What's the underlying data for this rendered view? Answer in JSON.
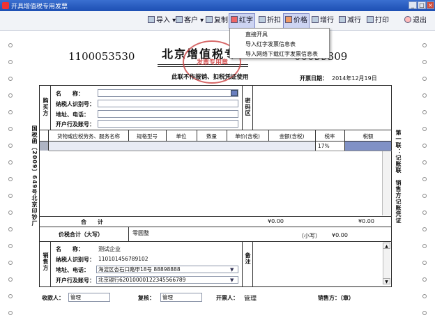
{
  "window": {
    "title": "开具增值税专用发票",
    "min": "_",
    "max": "□",
    "close": "×"
  },
  "toolbar": {
    "import": "导入",
    "client": "客户",
    "copy": "复制",
    "red": "红字",
    "discount": "折扣",
    "price": "价格",
    "add_row": "增行",
    "del_row": "减行",
    "print": "打印",
    "exit": "退出"
  },
  "menu": {
    "item1": "直接开具",
    "item2": "导入红字发票信息表",
    "item3": "导入网络下载红字发票信息表"
  },
  "invoice": {
    "code": "1100053530",
    "title": "北京增值税专",
    "number": "00099309",
    "notice": "此联不作报销、扣税凭证使用",
    "date_label": "开票日期：",
    "date": "2014年12月19日",
    "buyer_side": "购买方",
    "buyer_name_label": "名　　称：",
    "buyer_tax_label": "纳税人识别号：",
    "buyer_addr_label": "地址、电话：",
    "buyer_bank_label": "开户行及账号：",
    "cipher": "密码区",
    "left_vertical": "国税函〔2009〕649号北京印钞厂",
    "right_vertical": "第一联：记账联　销售方记账凭证",
    "headers": [
      "货物或应税劳务、服务名称",
      "规格型号",
      "单位",
      "数量",
      "单价(含税)",
      "金额(含税)",
      "税率",
      "税额"
    ],
    "tax_rate": "17%",
    "total_label": "合　　计",
    "total_amount": "¥0.00",
    "total_tax": "¥0.00",
    "sum_label": "价税合计（大写）",
    "sum_words": "零圆整",
    "sum_small_label": "（小写）",
    "sum_small": "¥0.00",
    "seller_side": "销售方",
    "seller_name_label": "名　　称：",
    "seller_name": "测试企业",
    "seller_tax_label": "纳税人识别号：",
    "seller_tax": "110101456789102",
    "seller_addr_label": "地址、电话：",
    "seller_addr": "海淀区杏石口路甲18号 88898888",
    "seller_bank_label": "开户行及账号：",
    "seller_bank": "北京银行62010000122345566789",
    "remark": "备注",
    "payee_label": "收款人：",
    "payee": "管理",
    "reviewer_label": "复核：",
    "reviewer": "管理",
    "drawer_label": "开票人：",
    "drawer": "管理",
    "seller_sign_label": "销售方：（章）",
    "seal_text": "发票专用章"
  }
}
